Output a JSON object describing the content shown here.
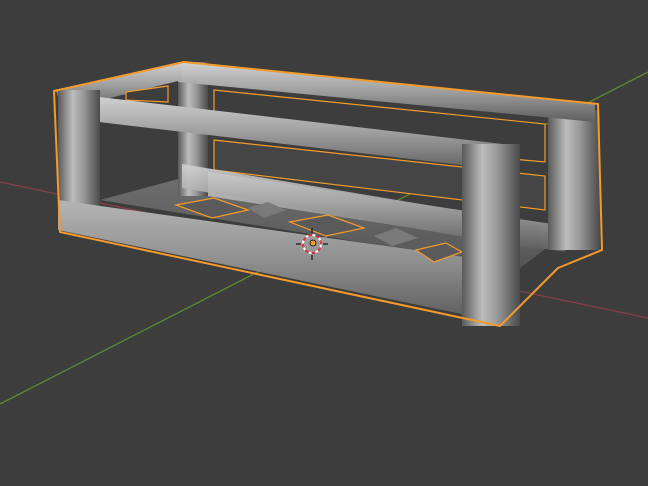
{
  "viewport": {
    "background": "#3d3d3d",
    "axis_colors": {
      "x": "#8a3f4a",
      "y": "#5f8a2e"
    },
    "selection_outline_color": "#f39b2c"
  },
  "scene": {
    "selected_object_icon": "mesh-frame-icon",
    "cursor_icon": "3d-cursor-icon",
    "origin_icon": "object-origin-icon"
  }
}
